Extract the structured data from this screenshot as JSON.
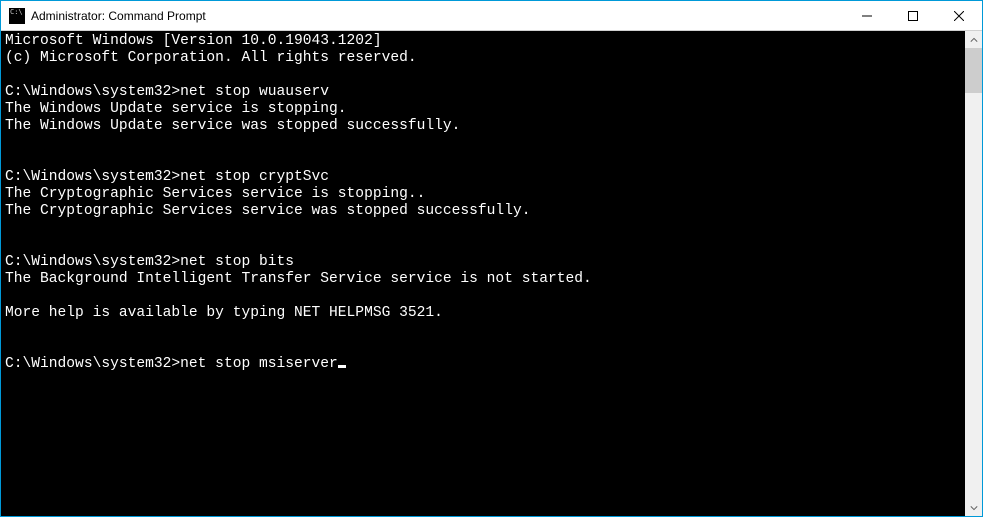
{
  "window": {
    "title": "Administrator: Command Prompt"
  },
  "terminal": {
    "header1": "Microsoft Windows [Version 10.0.19043.1202]",
    "header2": "(c) Microsoft Corporation. All rights reserved.",
    "blocks": [
      {
        "prompt": "C:\\Windows\\system32>",
        "command": "net stop wuauserv",
        "output": [
          "The Windows Update service is stopping.",
          "The Windows Update service was stopped successfully."
        ]
      },
      {
        "prompt": "C:\\Windows\\system32>",
        "command": "net stop cryptSvc",
        "output": [
          "The Cryptographic Services service is stopping..",
          "The Cryptographic Services service was stopped successfully."
        ]
      },
      {
        "prompt": "C:\\Windows\\system32>",
        "command": "net stop bits",
        "output": [
          "The Background Intelligent Transfer Service service is not started.",
          "",
          "More help is available by typing NET HELPMSG 3521."
        ]
      }
    ],
    "current": {
      "prompt": "C:\\Windows\\system32>",
      "command": "net stop msiserver"
    }
  }
}
